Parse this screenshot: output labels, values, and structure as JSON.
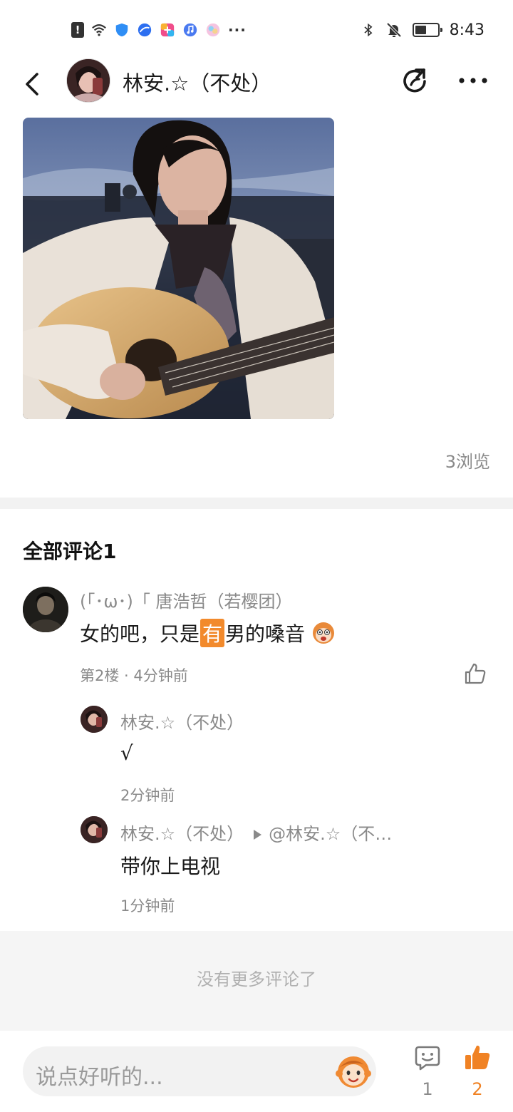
{
  "status_bar": {
    "time": "8:43",
    "left_icons": [
      "alert-icon",
      "wifi-icon",
      "shield-icon",
      "browser-icon",
      "app-icon",
      "music-icon",
      "palette-icon"
    ],
    "more_indicator": "···",
    "right_icons": [
      "bluetooth-icon",
      "mute-icon",
      "battery-icon"
    ],
    "battery_level": 0.5
  },
  "header": {
    "title": "林安.☆（不处）",
    "icons": [
      "back-icon",
      "share-icon",
      "more-icon"
    ]
  },
  "post": {
    "views": "3浏览"
  },
  "comments": {
    "title": "全部评论1",
    "items": [
      {
        "author": "(「･ω･)「 唐浩哲（若樱团）",
        "text_before": "女的吧，只是",
        "text_highlight": "有",
        "text_after": "男的嗓音",
        "meta": "第2楼 · 4分钟前",
        "replies": [
          {
            "author": "林安.☆（不处）",
            "text": "√",
            "time": "2分钟前"
          },
          {
            "author": "林安.☆（不处）",
            "reply_to": "@林安.☆（不…",
            "text": "带你上电视",
            "time": "1分钟前"
          }
        ]
      }
    ],
    "no_more": "没有更多评论了"
  },
  "bottom_bar": {
    "input_placeholder": "说点好听的...",
    "comment_count": "1",
    "like_count": "2",
    "accent_color": "#f08224"
  }
}
